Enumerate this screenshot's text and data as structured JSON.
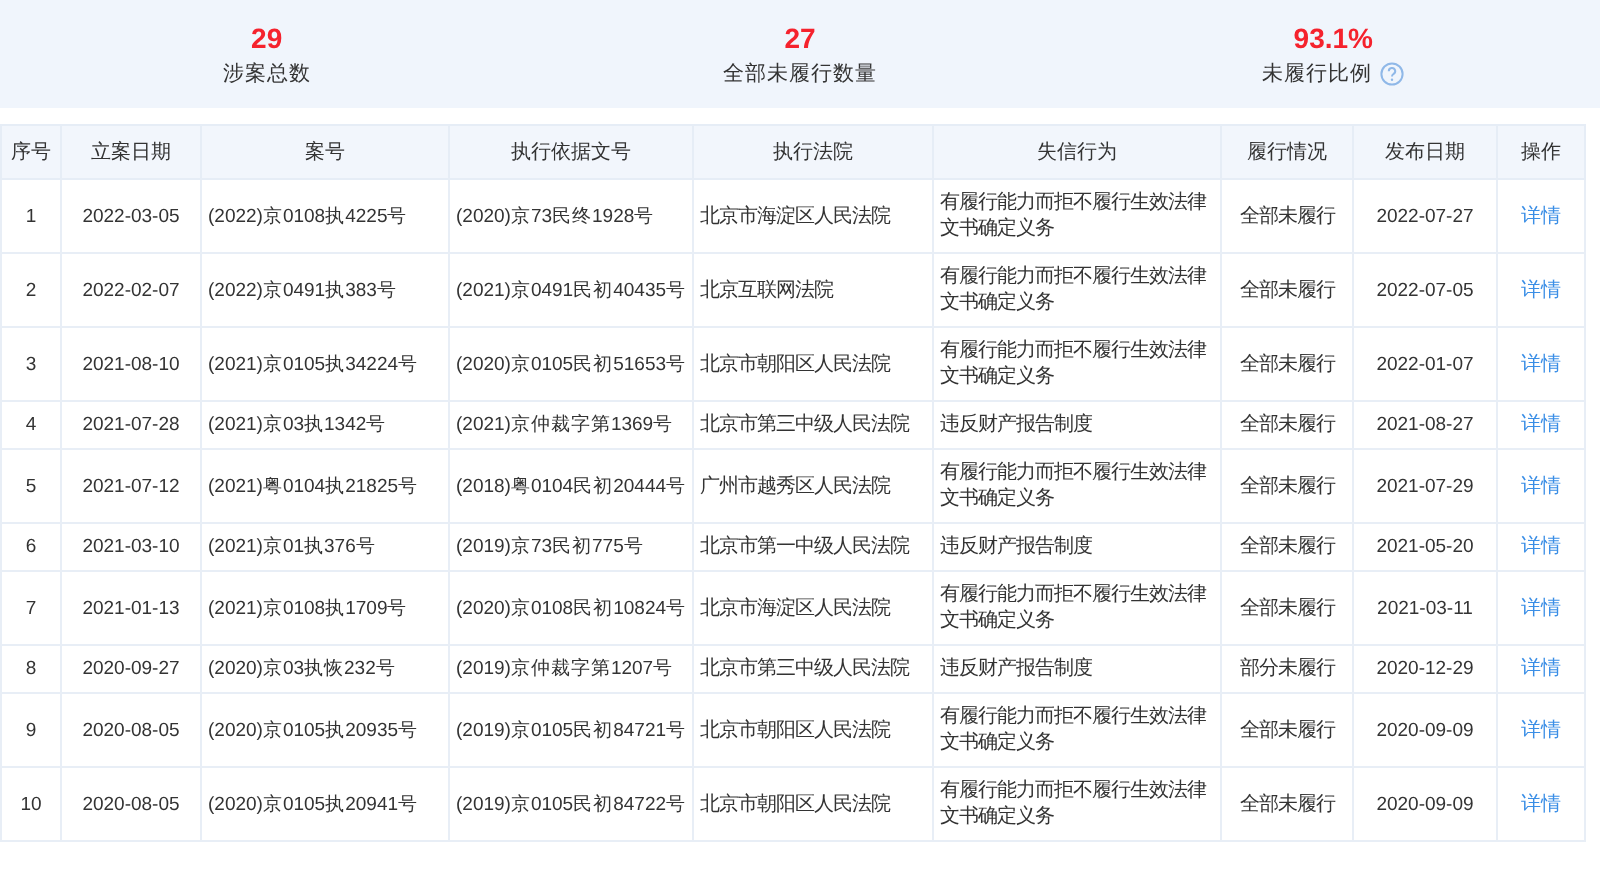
{
  "summary": [
    {
      "value": "29",
      "label": "涉案总数",
      "hint_icon": false
    },
    {
      "value": "27",
      "label": "全部未履行数量",
      "hint_icon": false
    },
    {
      "value": "93.1%",
      "label": "未履行比例",
      "hint_icon": true
    }
  ],
  "table": {
    "columns": [
      "序号",
      "立案日期",
      "案号",
      "执行依据文号",
      "执行法院",
      "失信行为",
      "履行情况",
      "发布日期",
      "操作"
    ],
    "rows": [
      {
        "cells": [
          "1",
          "2022-03-05",
          "(2022)京0108执4225号",
          "(2020)京73民终1928号",
          "北京市海淀区人民法院",
          "有履行能力而拒不履行生效法律文书确定义务",
          "全部未履行",
          "2022-07-27"
        ],
        "action": "详情"
      },
      {
        "cells": [
          "2",
          "2022-02-07",
          "(2022)京0491执383号",
          "(2021)京0491民初40435号",
          "北京互联网法院",
          "有履行能力而拒不履行生效法律文书确定义务",
          "全部未履行",
          "2022-07-05"
        ],
        "action": "详情"
      },
      {
        "cells": [
          "3",
          "2021-08-10",
          "(2021)京0105执34224号",
          "(2020)京0105民初51653号",
          "北京市朝阳区人民法院",
          "有履行能力而拒不履行生效法律文书确定义务",
          "全部未履行",
          "2022-01-07"
        ],
        "action": "详情"
      },
      {
        "cells": [
          "4",
          "2021-07-28",
          "(2021)京03执1342号",
          "(2021)京仲裁字第1369号",
          "北京市第三中级人民法院",
          "违反财产报告制度",
          "全部未履行",
          "2021-08-27"
        ],
        "action": "详情"
      },
      {
        "cells": [
          "5",
          "2021-07-12",
          "(2021)粤0104执21825号",
          "(2018)粤0104民初20444号",
          "广州市越秀区人民法院",
          "有履行能力而拒不履行生效法律文书确定义务",
          "全部未履行",
          "2021-07-29"
        ],
        "action": "详情"
      },
      {
        "cells": [
          "6",
          "2021-03-10",
          "(2021)京01执376号",
          "(2019)京73民初775号",
          "北京市第一中级人民法院",
          "违反财产报告制度",
          "全部未履行",
          "2021-05-20"
        ],
        "action": "详情"
      },
      {
        "cells": [
          "7",
          "2021-01-13",
          "(2021)京0108执1709号",
          "(2020)京0108民初10824号",
          "北京市海淀区人民法院",
          "有履行能力而拒不履行生效法律文书确定义务",
          "全部未履行",
          "2021-03-11"
        ],
        "action": "详情"
      },
      {
        "cells": [
          "8",
          "2020-09-27",
          "(2020)京03执恢232号",
          "(2019)京仲裁字第1207号",
          "北京市第三中级人民法院",
          "违反财产报告制度",
          "部分未履行",
          "2020-12-29"
        ],
        "action": "详情"
      },
      {
        "cells": [
          "9",
          "2020-08-05",
          "(2020)京0105执20935号",
          "(2019)京0105民初84721号",
          "北京市朝阳区人民法院",
          "有履行能力而拒不履行生效法律文书确定义务",
          "全部未履行",
          "2020-09-09"
        ],
        "action": "详情"
      },
      {
        "cells": [
          "10",
          "2020-08-05",
          "(2020)京0105执20941号",
          "(2019)京0105民初84722号",
          "北京市朝阳区人民法院",
          "有履行能力而拒不履行生效法律文书确定义务",
          "全部未履行",
          "2020-09-09"
        ],
        "action": "详情"
      }
    ]
  }
}
